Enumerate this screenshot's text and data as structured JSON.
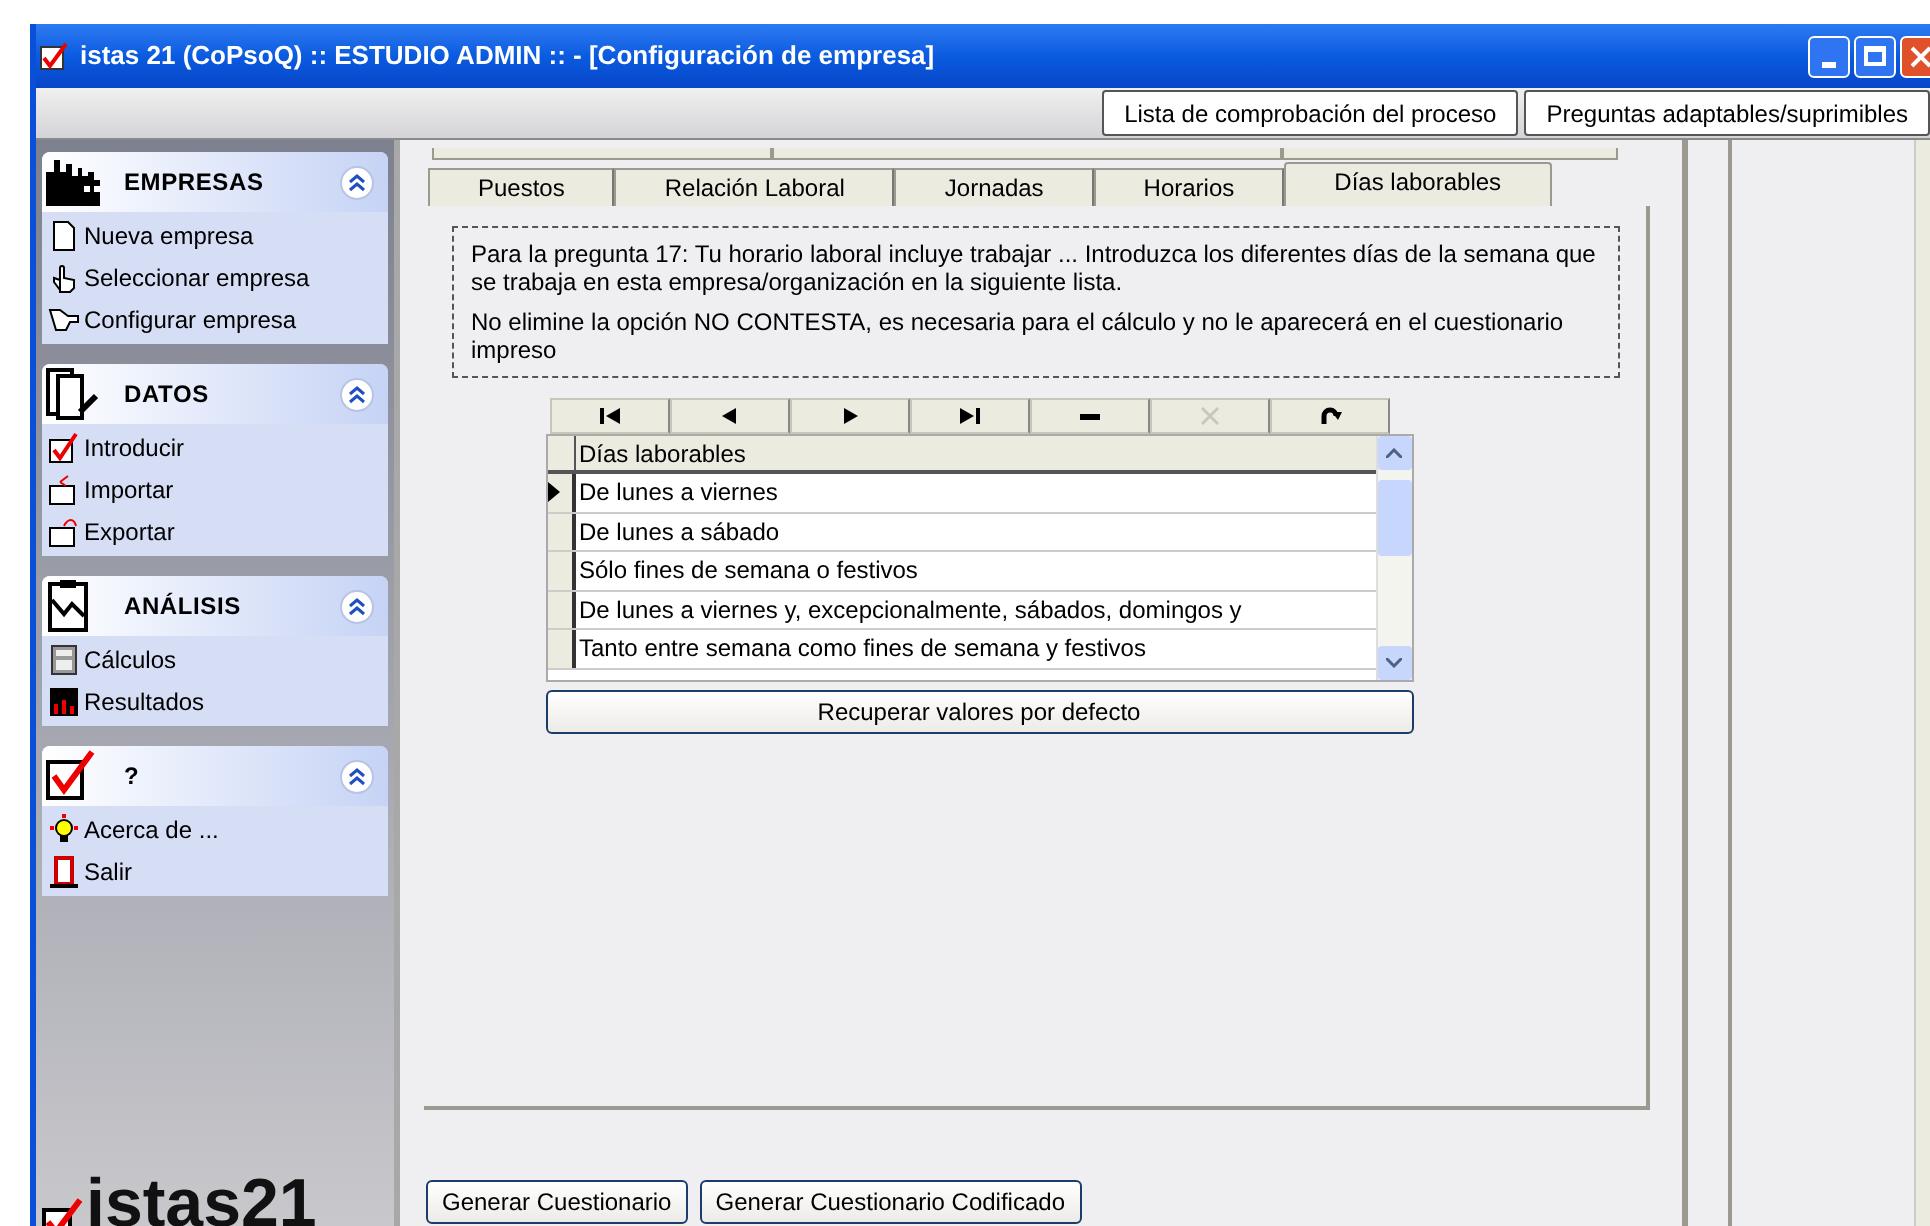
{
  "window": {
    "title": "istas 21 (CoPsoQ) :: ESTUDIO ADMIN :: - [Configuración de empresa]"
  },
  "toolbar": {
    "buttons": [
      "Lista de comprobación del proceso",
      "Preguntas adaptables/suprimibles"
    ]
  },
  "sidebar": {
    "sections": [
      {
        "title": "EMPRESAS",
        "expanded": true,
        "items": [
          "Nueva empresa",
          "Seleccionar empresa",
          "Configurar empresa"
        ]
      },
      {
        "title": "DATOS",
        "expanded": true,
        "items": [
          "Introducir",
          "Importar",
          "Exportar"
        ]
      },
      {
        "title": "ANÁLISIS",
        "expanded": true,
        "items": [
          "Cálculos",
          "Resultados"
        ]
      },
      {
        "title": "?",
        "expanded": true,
        "items": [
          "Acerca de ...",
          "Salir"
        ]
      }
    ],
    "logo": "istas21"
  },
  "tabs": [
    {
      "label": "Puestos",
      "selected": false
    },
    {
      "label": "Relación Laboral",
      "selected": false
    },
    {
      "label": "Jornadas",
      "selected": false
    },
    {
      "label": "Horarios",
      "selected": false
    },
    {
      "label": "Días laborables",
      "selected": true
    }
  ],
  "info": [
    "Para la pregunta 17: Tu horario laboral incluye trabajar ... Introduzca los diferentes días de la semana que se trabaja en esta empresa/organización en la siguiente lista.",
    "No elimine la opción NO CONTESTA, es necesaria para el cálculo y no le aparecerá en el cuestionario impreso"
  ],
  "grid": {
    "nav": [
      {
        "kind": "first",
        "disabled": false
      },
      {
        "kind": "prior",
        "disabled": false
      },
      {
        "kind": "next",
        "disabled": false
      },
      {
        "kind": "last",
        "disabled": false
      },
      {
        "kind": "delete",
        "disabled": false
      },
      {
        "kind": "cancel",
        "disabled": true
      },
      {
        "kind": "refresh",
        "disabled": false
      }
    ],
    "column": "Días laborables",
    "rows": [
      {
        "text": "De lunes a viernes",
        "selected": true
      },
      {
        "text": "De lunes a sábado",
        "selected": false
      },
      {
        "text": "Sólo fines de semana o festivos",
        "selected": false
      },
      {
        "text": "De lunes a viernes y, excepcionalmente, sábados, domingos y",
        "selected": false
      },
      {
        "text": "Tanto entre semana como fines de semana y festivos",
        "selected": false
      }
    ]
  },
  "reset_button": "Recuperar valores por defecto",
  "bottom_buttons": [
    "Generar Cuestionario",
    "Generar Cuestionario Codificado"
  ]
}
